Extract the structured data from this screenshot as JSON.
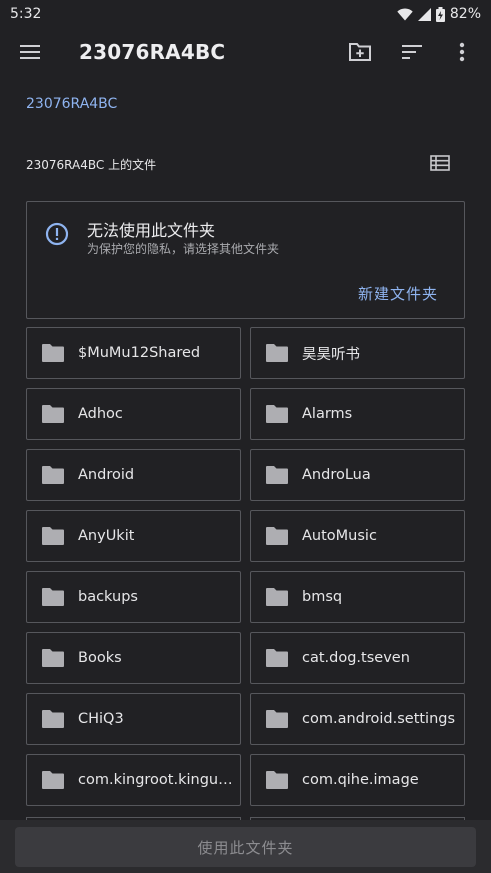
{
  "status_bar": {
    "time": "5:32",
    "battery": "82%",
    "icons": [
      "wifi-icon",
      "signal-icon",
      "battery-icon"
    ]
  },
  "app_bar": {
    "title": "23076RA4BC",
    "icons": [
      "menu-icon",
      "create-folder-icon",
      "sort-icon",
      "more-vert-icon"
    ]
  },
  "breadcrumb": "23076RA4BC",
  "section": {
    "title": "23076RA4BC 上的文件",
    "view_icon": "list-view-icon"
  },
  "notice": {
    "icon": "info-icon",
    "title": "无法使用此文件夹",
    "subtitle": "为保护您的隐私，请选择其他文件夹",
    "action": "新建文件夹"
  },
  "folders": [
    "$MuMu12Shared",
    "昊昊听书",
    "Adhoc",
    "Alarms",
    "Android",
    "AndroLua",
    "AnyUkit",
    "AutoMusic",
    "backups",
    "bmsq",
    "Books",
    "cat.dog.tseven",
    "CHiQ3",
    "com.android.settings",
    "com.kingroot.kingus…",
    "com.qihe.image"
  ],
  "bottom": {
    "button_label": "使用此文件夹"
  },
  "colors": {
    "background": "#212124",
    "accent": "#8fb4f0",
    "tile_border": "#56575c",
    "folder_icon": "#aeaeb2"
  }
}
